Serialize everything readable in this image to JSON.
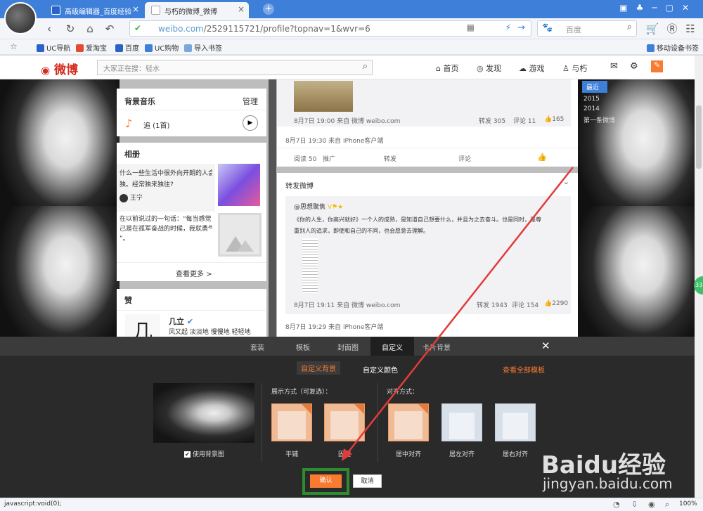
{
  "browser": {
    "tabs": [
      {
        "label": "高级编辑器_百度经验"
      },
      {
        "label": "与朽的微博_微博"
      }
    ],
    "url_host": "weibo.com",
    "url_path": "/2529115721/profile?topnav=1&wvr=6",
    "search_placeholder": "百度",
    "bookmarks": [
      "UC导航",
      "爱淘宝",
      "百度",
      "UC购物",
      "导入书签"
    ],
    "mobile_bookmarks": "移动设备书签",
    "status_text": "javascript:void(0);",
    "zoom": "100%"
  },
  "weibo": {
    "logo": "微博",
    "search_placeholder": "大家正在搜：轻水",
    "nav": [
      "首页",
      "发现",
      "游戏",
      "与朽"
    ],
    "music": {
      "title": "背景音乐",
      "manage": "管理",
      "song": "追 (1首)"
    },
    "album": {
      "title": "相册",
      "line1": "什么一些生活中很外向开朗的人会喜欢",
      "line2": "独。经常独来独往?",
      "user": "王宁",
      "line3": "在以前说过的一句话：“每当感觉自",
      "line4": "己是在孤军奋战的时候，我就勇气倍",
      "line5": "”。",
      "more": "查看更多 >"
    },
    "likes": {
      "title": "赞",
      "name": "几立",
      "text": "风又起 淡淡地 慢慢地 轻轻地"
    },
    "post1": {
      "meta": "8月7日 19:00 来自 微博 weibo.com",
      "repost": "转发 305",
      "comment": "评论 11",
      "like": "165",
      "time": "8月7日 19:30 来自 iPhone客户端",
      "read": "阅读 50",
      "promote": "推广",
      "a_repost": "转发",
      "a_comment": "评论"
    },
    "post2": {
      "header": "转发微博",
      "author": "@思想聚焦",
      "text1": "《你的人生，你高兴就好》一个人的成熟，是知道自己想要什么，并且为之去奋斗。也是同时，是尊",
      "text2": "重别人的追求，即使和自己的不同，也会愿意去理解。",
      "meta": "8月7日 19:11 来自 微博 weibo.com",
      "repost": "转发 1943",
      "comment": "评论 154",
      "like": "2290",
      "time": "8月7日 19:29 来自 iPhone客户端"
    },
    "years": [
      "最近",
      "2015",
      "2014",
      "第一条微博"
    ]
  },
  "panel": {
    "tabs": [
      "套装",
      "模板",
      "封面图",
      "自定义",
      "卡片背景"
    ],
    "subtabs": [
      "自定义背景",
      "自定义颜色",
      "查看全部模板"
    ],
    "use_bg_label": "使用背景图",
    "display_label": "展示方式（可复选）：",
    "align_label": "对齐方式：",
    "display_opts": [
      "平铺",
      "固定"
    ],
    "align_opts": [
      "居中对齐",
      "居左对齐",
      "居右对齐"
    ],
    "confirm": "确认",
    "cancel": "取消"
  },
  "watermark": {
    "brand": "Baidu经验",
    "url": "jingyan.baidu.com"
  },
  "colors": {
    "accent": "#f97b32",
    "weibo_red": "#d52b1e",
    "highlight_box": "#2e8b2e",
    "arrow": "#e23b3b"
  }
}
